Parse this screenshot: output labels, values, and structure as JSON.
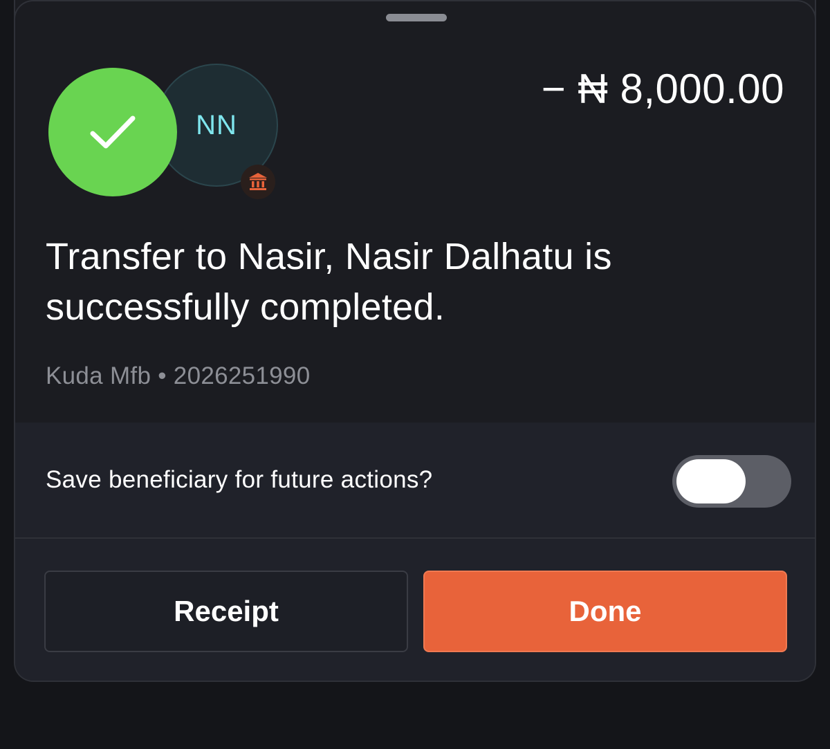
{
  "amount": "− ₦ 8,000.00",
  "recipient": {
    "initials": "NN"
  },
  "message": "Transfer to Nasir, Nasir Dalhatu is successfully completed.",
  "account_line": "Kuda Mfb • 2026251990",
  "save_beneficiary": {
    "label": "Save beneficiary for future actions?",
    "enabled": false
  },
  "buttons": {
    "receipt": "Receipt",
    "done": "Done"
  },
  "icons": {
    "success": "checkmark-icon",
    "bank": "bank-icon"
  },
  "colors": {
    "success_green": "#69d451",
    "accent_orange": "#e8633a",
    "initials_cyan": "#7fe6ee"
  }
}
